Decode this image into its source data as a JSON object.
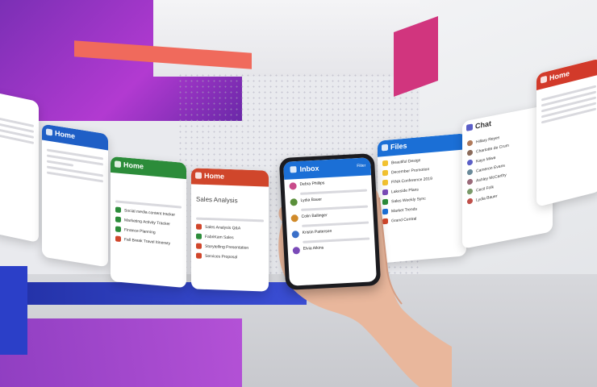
{
  "cards": {
    "home_blue": {
      "title": "Home",
      "color": "#1f5fc6"
    },
    "home_green": {
      "title": "Home",
      "color": "#2c8c3a",
      "rows": [
        "Social media content tracker",
        "Marketing Activity Tracker",
        "Finance Planning",
        "Fall Break Travel Itinerary"
      ]
    },
    "home_red": {
      "title": "Home",
      "color": "#d0462b",
      "doc_title": "Sales Analysis",
      "rows": [
        "Sales Analysis Q&A",
        "FabriKam Sales",
        "Storytelling Presentation",
        "Services Proposal"
      ]
    },
    "files": {
      "title": "Files",
      "color": "#1b6fd6",
      "rows": [
        "Beautiful Design",
        "December Promotion",
        "FINA Conference 2019",
        "Lakeside Plans",
        "Sales Weekly Sync",
        "Market Trends",
        "Grand Central"
      ]
    },
    "chat": {
      "title": "Chat",
      "color": "#ffffff",
      "rows": [
        "Hillary Reyes",
        "Charlotte de Crum",
        "Kayo Miwa",
        "Cameron Evans",
        "Ashley McCarthy",
        "Cecil Folk",
        "Lydia Bauer"
      ]
    },
    "home_far_right": {
      "title": "Home",
      "color": "#d23a2a"
    }
  },
  "phone": {
    "title": "Inbox",
    "filter": "Filter",
    "mails": [
      {
        "from": "Debra Phillips",
        "color": "#c84b8a"
      },
      {
        "from": "Lydia Bauer",
        "color": "#5a8f3a"
      },
      {
        "from": "Colin Ballinger",
        "color": "#d08a2a"
      },
      {
        "from": "Kristin Patterson",
        "color": "#3a6fc8"
      },
      {
        "from": "Elvia Atkins",
        "color": "#7a4ab8"
      }
    ]
  }
}
